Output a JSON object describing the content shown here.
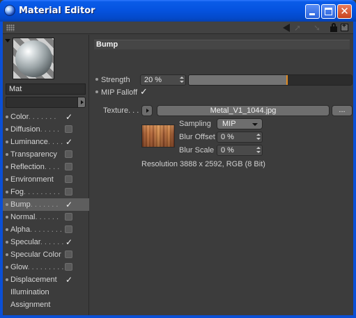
{
  "window": {
    "title": "Material Editor"
  },
  "material": {
    "name": "Mat"
  },
  "channels": [
    {
      "label": "Color",
      "dots": ". . . . . . .",
      "has_checkbox": true,
      "checked": true,
      "has_dot": true,
      "selected": false
    },
    {
      "label": "Diffusion",
      "dots": ". . . . .",
      "has_checkbox": true,
      "checked": false,
      "has_dot": true,
      "selected": false
    },
    {
      "label": "Luminance",
      "dots": ". . . .",
      "has_checkbox": true,
      "checked": true,
      "has_dot": true,
      "selected": false
    },
    {
      "label": "Transparency",
      "dots": "",
      "has_checkbox": true,
      "checked": false,
      "has_dot": true,
      "selected": false
    },
    {
      "label": "Reflection",
      "dots": ". . . .",
      "has_checkbox": true,
      "checked": false,
      "has_dot": true,
      "selected": false
    },
    {
      "label": "Environment",
      "dots": "",
      "has_checkbox": true,
      "checked": false,
      "has_dot": true,
      "selected": false
    },
    {
      "label": "Fog",
      "dots": ". . . . . . . . .",
      "has_checkbox": true,
      "checked": false,
      "has_dot": true,
      "selected": false
    },
    {
      "label": "Bump",
      "dots": ". . . . . . .",
      "has_checkbox": true,
      "checked": true,
      "has_dot": true,
      "selected": true
    },
    {
      "label": "Normal",
      "dots": ". . . . . .",
      "has_checkbox": true,
      "checked": false,
      "has_dot": true,
      "selected": false
    },
    {
      "label": "Alpha",
      "dots": ". . . . . . . .",
      "has_checkbox": true,
      "checked": false,
      "has_dot": true,
      "selected": false
    },
    {
      "label": "Specular",
      "dots": ". . . . . .",
      "has_checkbox": true,
      "checked": true,
      "has_dot": true,
      "selected": false
    },
    {
      "label": "Specular Color",
      "dots": "",
      "has_checkbox": true,
      "checked": false,
      "has_dot": true,
      "selected": false
    },
    {
      "label": "Glow",
      "dots": ". . . . . . . . .",
      "has_checkbox": true,
      "checked": false,
      "has_dot": true,
      "selected": false
    },
    {
      "label": "Displacement",
      "dots": "",
      "has_checkbox": true,
      "checked": true,
      "has_dot": true,
      "selected": false
    },
    {
      "label": "Illumination",
      "dots": "",
      "has_checkbox": false,
      "checked": false,
      "has_dot": false,
      "selected": false
    },
    {
      "label": "Assignment",
      "dots": "",
      "has_checkbox": false,
      "checked": false,
      "has_dot": false,
      "selected": false
    }
  ],
  "bump": {
    "section_title": "Bump",
    "strength_label": "Strength",
    "strength_value": "20 %",
    "strength_fraction": 0.6,
    "mip_falloff_label": "MIP Falloff",
    "mip_falloff_checked": true,
    "texture_label": "Texture. . .",
    "texture_file": "Metal_V1_1044.jpg",
    "browse_label": "...",
    "sampling_label": "Sampling",
    "sampling_value": "MIP",
    "blur_offset_label": "Blur Offset",
    "blur_offset_value": "0 %",
    "blur_scale_label": "Blur Scale",
    "blur_scale_value": "0 %",
    "resolution_text": "Resolution 3888 x 2592, RGB (8 Bit)"
  },
  "colors": {
    "titlebar": "#0553e0",
    "panel_bg": "#3c3c3c",
    "slider_marker": "#e08a20",
    "selected_row": "#5e5e5e"
  }
}
